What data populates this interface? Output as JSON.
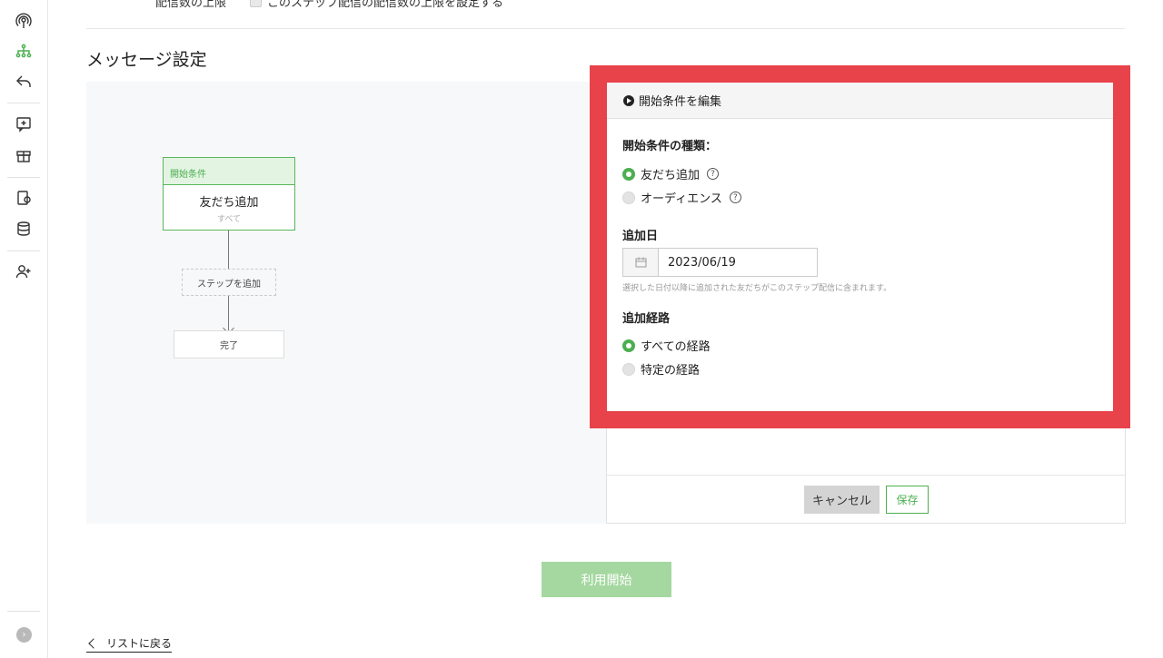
{
  "top_row": {
    "label": "配信数の上限",
    "checkbox_label": "このステップ配信の配信数の上限を設定する"
  },
  "section_title": "メッセージ設定",
  "flow": {
    "start_header": "開始条件",
    "start_title": "友だち追加",
    "start_sub": "すべて",
    "add_step": "ステップを追加",
    "done": "完了"
  },
  "dialog": {
    "title": "開始条件を編集",
    "type_label": "開始条件の種類：",
    "type_options": [
      {
        "label": "友だち追加",
        "selected": true
      },
      {
        "label": "オーディエンス",
        "selected": false
      }
    ],
    "date_label": "追加日",
    "date_value": "2023/06/19",
    "date_hint": "選択した日付以降に追加された友だちがこのステップ配信に含まれます。",
    "route_label": "追加経路",
    "route_options": [
      {
        "label": "すべての経路",
        "selected": true
      },
      {
        "label": "特定の経路",
        "selected": false
      }
    ],
    "help_glyph": "?"
  },
  "footer": {
    "cancel": "キャンセル",
    "save": "保存"
  },
  "start_button": "利用開始",
  "back_link": "リストに戻る",
  "rail_expand_glyph": "›",
  "colors": {
    "accent_green": "#4caf50",
    "highlight_red": "#e8434b",
    "start_button": "#a5d8a0"
  },
  "rail_icons": [
    "broadcast-icon",
    "flow-icon",
    "reply-icon",
    "add-message-icon",
    "gift-icon",
    "coupon-icon",
    "database-icon",
    "add-user-icon"
  ]
}
